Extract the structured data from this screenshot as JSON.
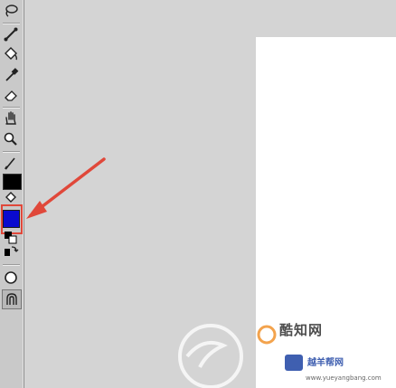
{
  "toolbar": {
    "tools": [
      {
        "name": "lasso-icon"
      },
      {
        "name": "bone-icon"
      },
      {
        "name": "paint-bucket-icon"
      },
      {
        "name": "eyedropper-icon"
      },
      {
        "name": "eraser-icon"
      },
      {
        "name": "hand-icon"
      },
      {
        "name": "zoom-icon"
      },
      {
        "name": "pen-icon"
      },
      {
        "name": "stroke-color-icon"
      },
      {
        "name": "fill-color-icon"
      },
      {
        "name": "swap-colors-icon"
      },
      {
        "name": "object-drawing-icon"
      },
      {
        "name": "snap-magnet-icon"
      }
    ],
    "stroke_color": "#000000",
    "fill_color": "#0a0acf"
  },
  "canvas": {
    "background": "#ffffff"
  },
  "annotation": {
    "color": "#e0483a"
  },
  "watermark": {
    "brand": "酷知网",
    "site_cn": "越羊帮网",
    "site_url": "www.yueyangbang.com"
  }
}
